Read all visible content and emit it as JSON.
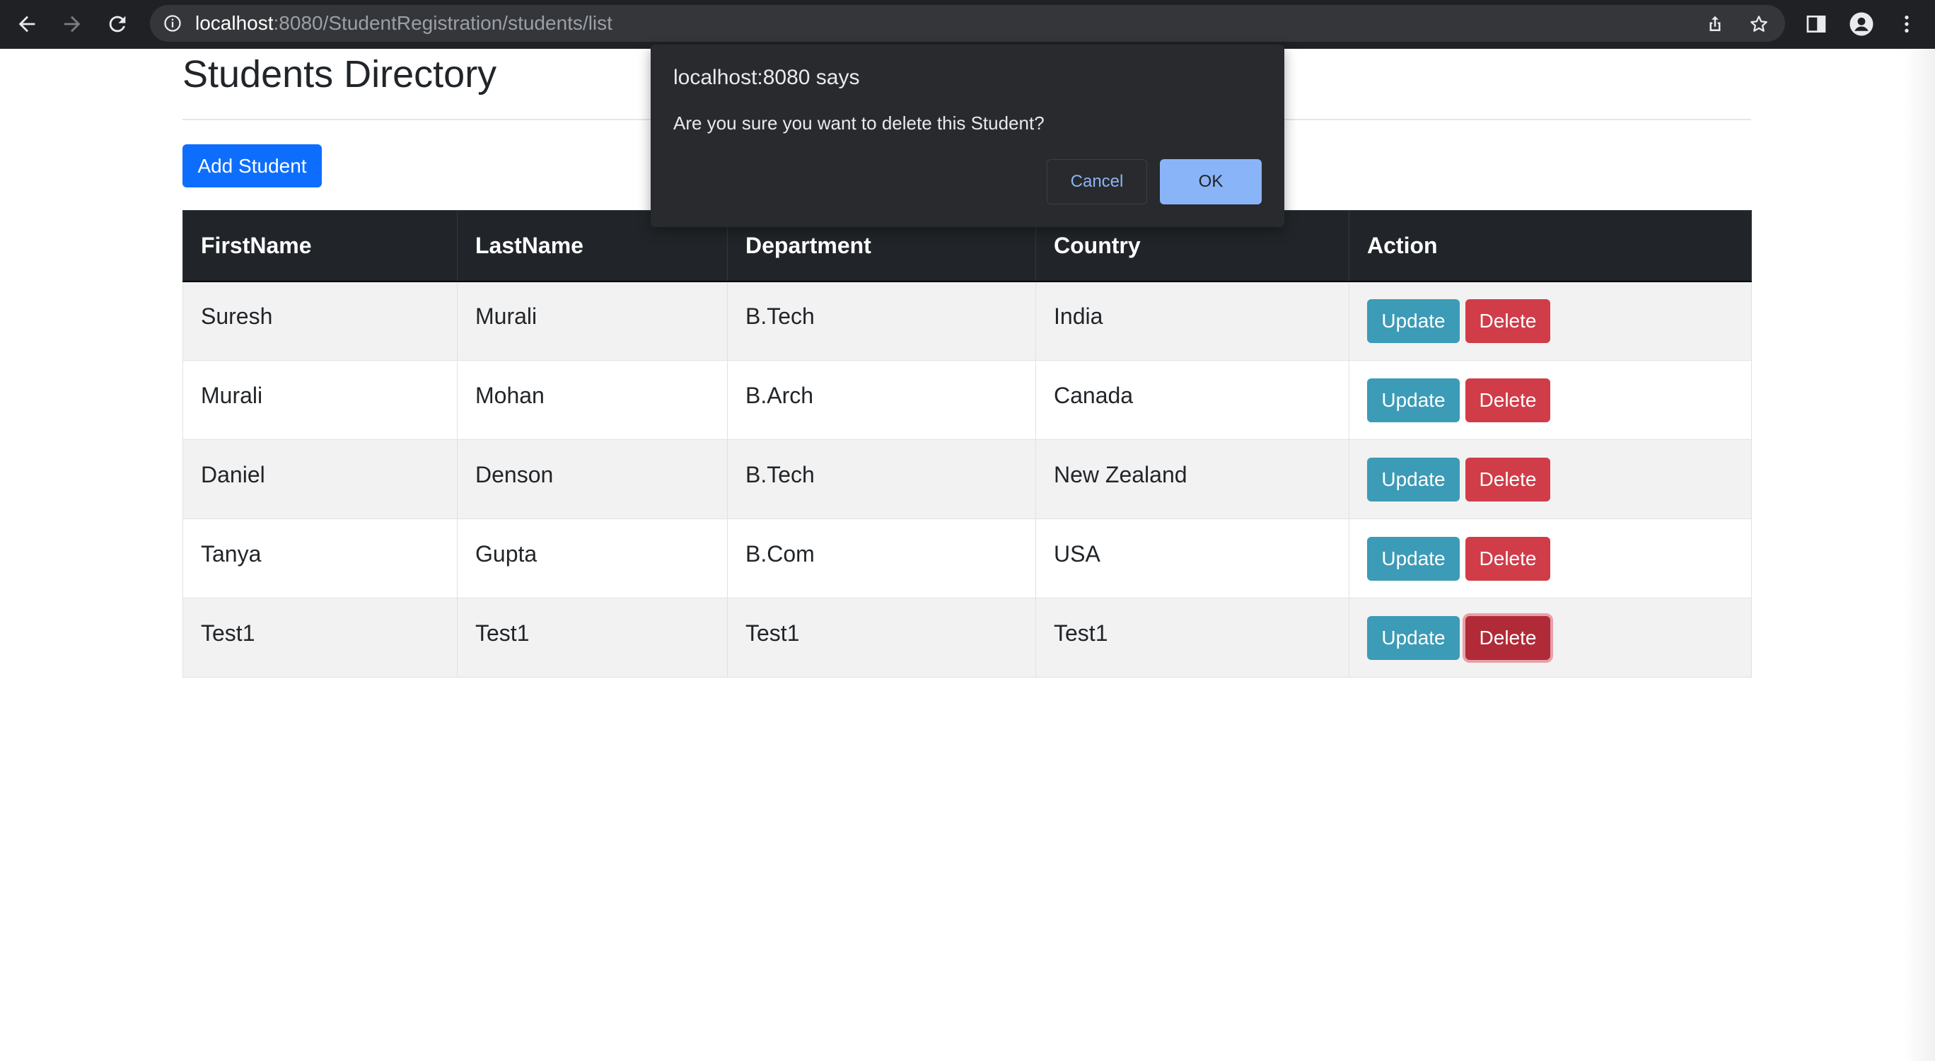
{
  "browser": {
    "url_host": "localhost",
    "url_rest": ":8080/StudentRegistration/students/list",
    "icons": [
      "back-arrow-icon",
      "forward-arrow-icon",
      "reload-icon",
      "info-icon",
      "share-icon",
      "star-icon",
      "side-panel-icon",
      "profile-icon",
      "kebab-menu-icon"
    ]
  },
  "page": {
    "title": "Students Directory",
    "add_button": "Add Student"
  },
  "table": {
    "headers": [
      "FirstName",
      "LastName",
      "Department",
      "Country",
      "Action"
    ],
    "rows": [
      {
        "first": "Suresh",
        "last": "Murali",
        "department": "B.Tech",
        "country": "India"
      },
      {
        "first": "Murali",
        "last": "Mohan",
        "department": "B.Arch",
        "country": "Canada"
      },
      {
        "first": "Daniel",
        "last": "Denson",
        "department": "B.Tech",
        "country": "New Zealand"
      },
      {
        "first": "Tanya",
        "last": "Gupta",
        "department": "B.Com",
        "country": "USA"
      },
      {
        "first": "Test1",
        "last": "Test1",
        "department": "Test1",
        "country": "Test1"
      }
    ],
    "update_label": "Update",
    "delete_label": "Delete"
  },
  "dialog": {
    "title": "localhost:8080 says",
    "message": "Are you sure you want to delete this Student?",
    "cancel": "Cancel",
    "ok": "OK"
  },
  "colors": {
    "primary": "#0d6efd",
    "info": "#3c9bb6",
    "danger": "#d03c48",
    "table_header": "#212529",
    "dialog_bg": "#292a2d",
    "dialog_accent": "#8ab4f8"
  }
}
